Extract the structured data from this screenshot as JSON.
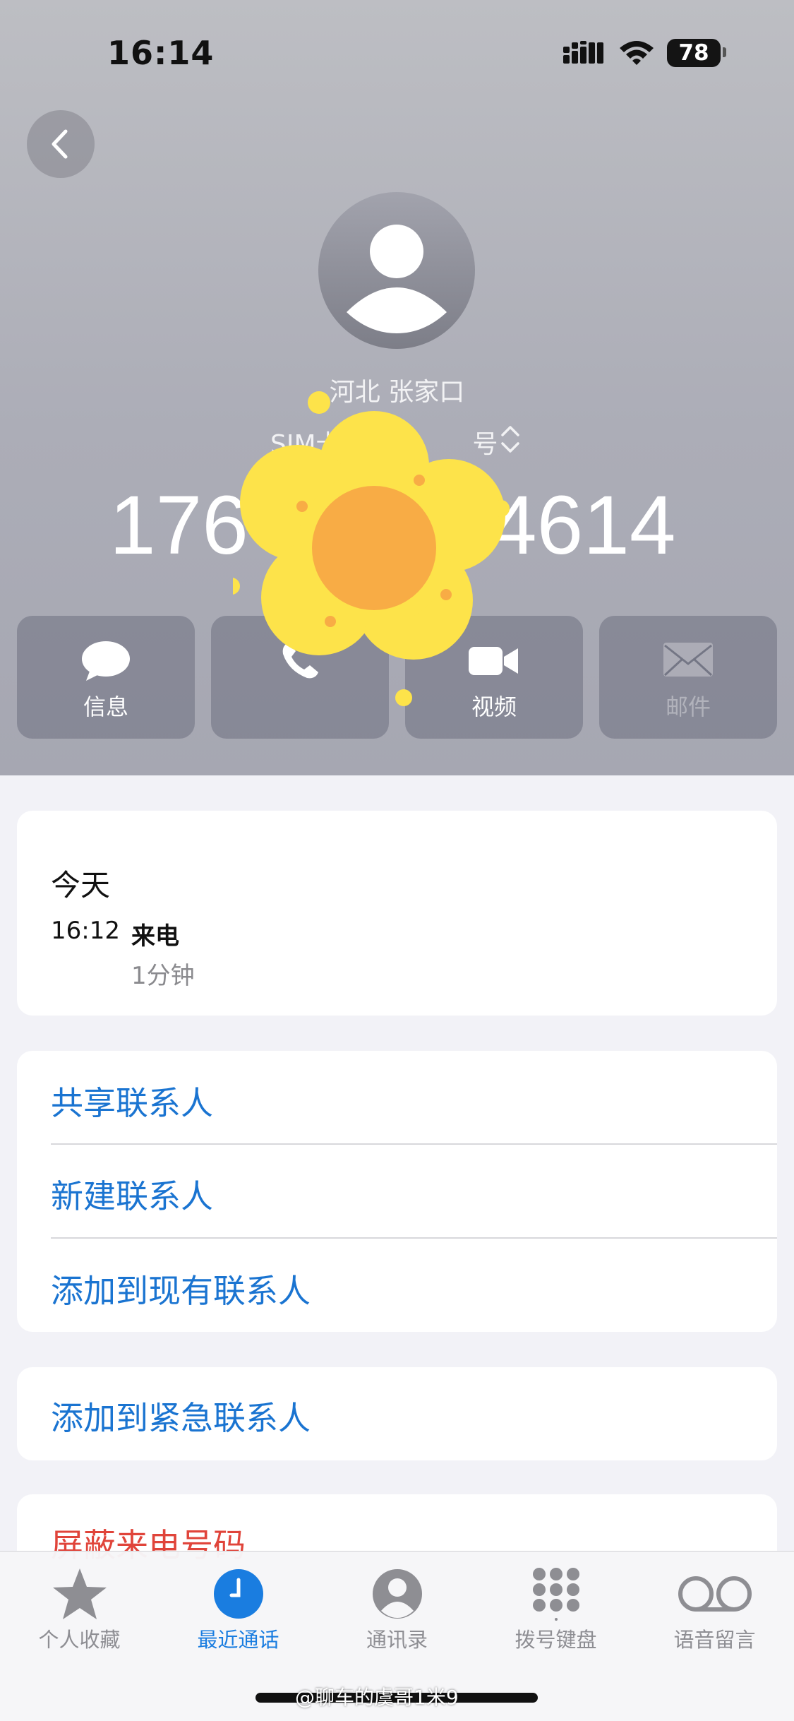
{
  "status_bar": {
    "time": "16:14",
    "battery": "78"
  },
  "contact": {
    "location": "河北 张家口",
    "sim": "SIM卡：",
    "sim_suffix": "号",
    "number_start": "176",
    "number_end": "4614"
  },
  "actions": [
    {
      "label": "信息",
      "icon": "message-bubble-icon"
    },
    {
      "label": "",
      "icon": "phone-icon"
    },
    {
      "label": "视频",
      "icon": "video-camera-icon"
    },
    {
      "label": "邮件",
      "icon": "mail-icon"
    }
  ],
  "recent": {
    "day": "今天",
    "time": "16:12",
    "type": "来电",
    "duration": "1分钟"
  },
  "options": {
    "share": "共享联系人",
    "new": "新建联系人",
    "add_existing": "添加到现有联系人",
    "emergency": "添加到紧急联系人",
    "block": "屏蔽来电号码"
  },
  "tabs": [
    {
      "label": "个人收藏",
      "icon": "star-icon"
    },
    {
      "label": "最近通话",
      "icon": "clock-icon"
    },
    {
      "label": "通讯录",
      "icon": "person-icon"
    },
    {
      "label": "拨号键盘",
      "icon": "keypad-icon"
    },
    {
      "label": "语音留言",
      "icon": "voicemail-icon"
    }
  ],
  "watermark": "@聊车的虞哥1米9",
  "colors": {
    "accent": "#1a74d1",
    "destructive": "#e0443a",
    "sticker_petal": "#fde34a",
    "sticker_center": "#f8ac45"
  }
}
